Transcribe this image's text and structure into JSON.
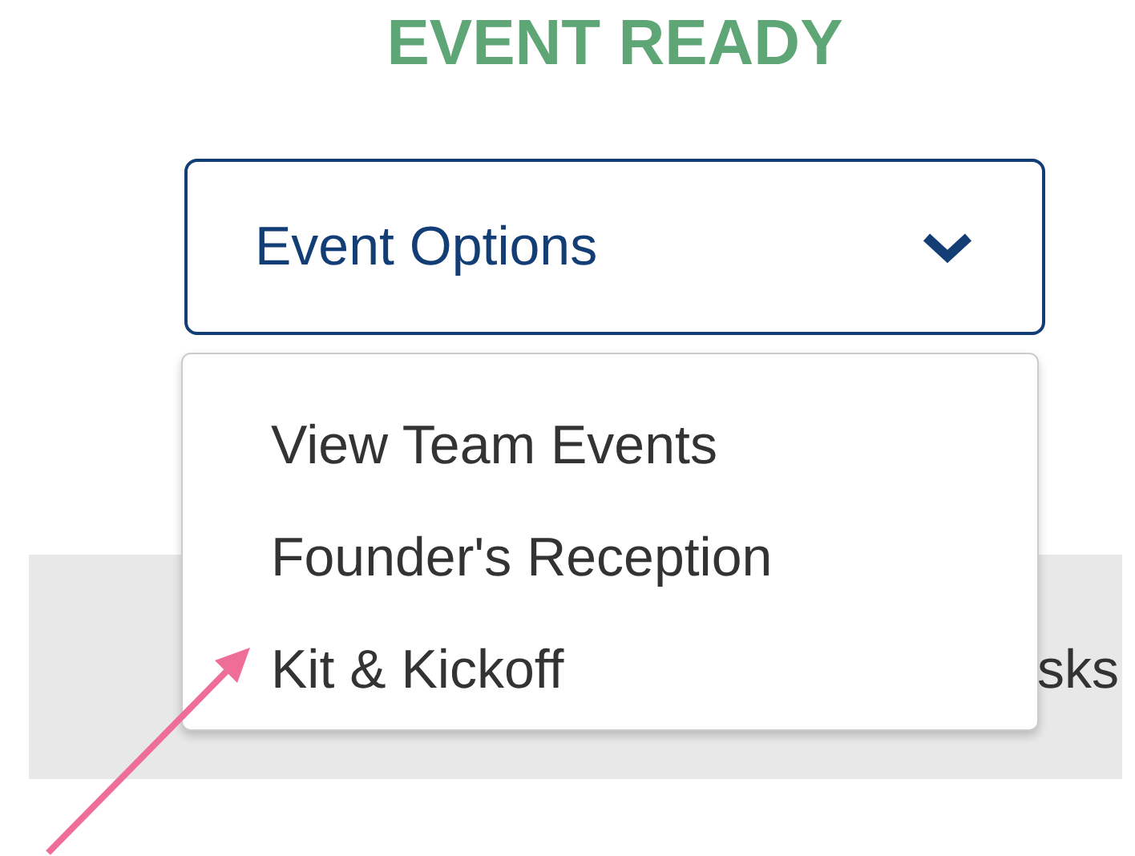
{
  "title": "EVENT READY",
  "dropdown": {
    "label": "Event Options",
    "expanded": true
  },
  "menu_items": [
    {
      "label": "View Team Events"
    },
    {
      "label": "Founder's Reception"
    },
    {
      "label": "Kit & Kickoff"
    }
  ],
  "background_text": "sks"
}
